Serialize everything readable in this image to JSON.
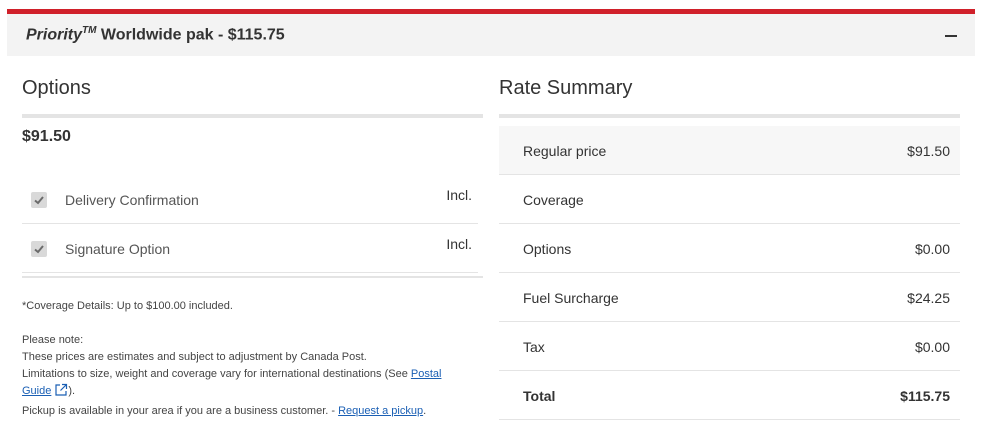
{
  "header": {
    "brand": "Priority",
    "trademark": "TM",
    "title_rest": " Worldwide pak - $115.75",
    "collapse_icon": "minus-icon"
  },
  "options": {
    "title": "Options",
    "price": "$91.50",
    "items": [
      {
        "label": "Delivery Confirmation",
        "value": "Incl.",
        "checked": true
      },
      {
        "label": "Signature Option",
        "value": "Incl.",
        "checked": true
      }
    ],
    "coverage_note": "*Coverage Details: Up to $100.00 included.",
    "notes": {
      "heading": "Please note:",
      "line1": "These prices are estimates and subject to adjustment by Canada Post.",
      "line2_prefix": "Limitations to size, weight and coverage vary for international destinations (See ",
      "postal_link_1": "Postal",
      "postal_link_2": "Guide",
      "line2_suffix": ").",
      "line3_prefix": "Pickup is available in your area if you are a business customer. - ",
      "pickup_link": "Request a pickup",
      "line3_suffix": "."
    }
  },
  "rate_summary": {
    "title": "Rate Summary",
    "rows": [
      {
        "label": "Regular price",
        "value": "$91.50"
      },
      {
        "label": "Coverage",
        "value": ""
      },
      {
        "label": "Options",
        "value": "$0.00"
      },
      {
        "label": "Fuel Surcharge",
        "value": "$24.25"
      },
      {
        "label": "Tax",
        "value": "$0.00"
      },
      {
        "label": "Total",
        "value": "$115.75"
      }
    ]
  },
  "colors": {
    "accent": "#d0202a",
    "link": "#1a5fb4"
  }
}
